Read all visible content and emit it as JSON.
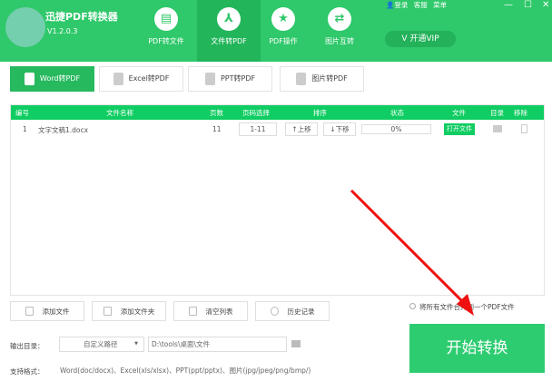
{
  "app": {
    "title": "迅捷PDF转换器",
    "version": "V1.2.0.3"
  },
  "header": {
    "links": [
      "登录",
      "客服",
      "菜单"
    ],
    "tabs": [
      {
        "label": "PDF转文件",
        "icon": "pdf-icon"
      },
      {
        "label": "文件转PDF",
        "icon": "acrobat-icon",
        "active": true
      },
      {
        "label": "PDF操作",
        "icon": "star-icon"
      },
      {
        "label": "图片互转",
        "icon": "swap-icon"
      }
    ],
    "vip": "开通VIP"
  },
  "subtabs": [
    "Word转PDF",
    "Excel转PDF",
    "PPT转PDF",
    "图片转PDF"
  ],
  "table": {
    "headers": [
      "编号",
      "文件名称",
      "页数",
      "页码选择",
      "排序",
      "状态",
      "文件",
      "目录",
      "移除"
    ],
    "rows": [
      {
        "no": "1",
        "name": "文字文稿1.docx",
        "pages": "11",
        "range": "1-11",
        "up": "↑上移",
        "down": "↓下移",
        "progress": "0%",
        "open": "打开文件"
      }
    ]
  },
  "actions": [
    "添加文件",
    "添加文件夹",
    "清空列表",
    "历史记录"
  ],
  "merge_label": "将所有文件合并到一个PDF文件",
  "output": {
    "label": "输出目录：",
    "mode": "自定义路径",
    "path": "D:\\tools\\桌面\\文件"
  },
  "formats": {
    "label": "支持格式：",
    "value": "Word(doc/docx)、Excel(xls/xlsx)、PPT(ppt/pptx)、图片(jpg/jpeg/png/bmp/)"
  },
  "start": "开始转换",
  "colors": {
    "brand": "#2fc86a",
    "table_header": "#0fcd62"
  }
}
